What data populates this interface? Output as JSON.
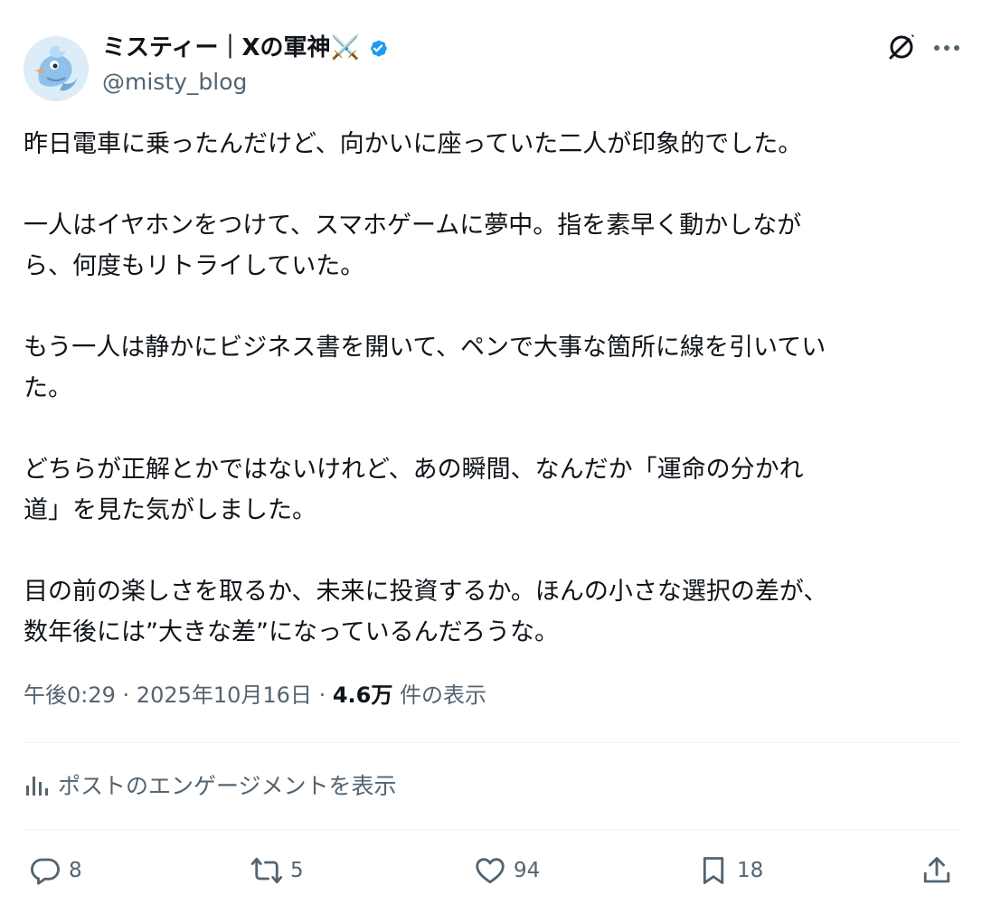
{
  "author": {
    "display_name": "ミスティー｜Xの軍神⚔️",
    "handle": "@misty_blog",
    "verified_color": "#1d9bf0"
  },
  "tweet": {
    "paragraphs": [
      "昨日電車に乗ったんだけど、向かいに座っていた二人が印象的でした。",
      "一人はイヤホンをつけて、スマホゲームに夢中。指を素早く動かしなが\nら、何度もリトライしていた。",
      "もう一人は静かにビジネス書を開いて、ペンで大事な箇所に線を引いてい\nた。",
      "どちらが正解とかではないけれど、あの瞬間、なんだか「運命の分かれ\n道」を見た気がしました。",
      "目の前の楽しさを取るか、未来に投資するか。ほんの小さな選択の差が、\n数年後には”大きな差”になっているんだろうな。"
    ],
    "time": "午後0:29",
    "separator": " · ",
    "date": "2025年10月16日",
    "views_count": "4.6万",
    "views_label": " 件の表示"
  },
  "engagement": {
    "label": "ポストのエンゲージメントを表示"
  },
  "actions": {
    "reply_count": "8",
    "repost_count": "5",
    "like_count": "94",
    "bookmark_count": "18"
  },
  "icons": {
    "avatar": "phoenix-avatar-icon",
    "verified": "verified-badge-icon",
    "grok": "grok-icon",
    "more": "more-icon",
    "analytics": "bar-chart-icon",
    "reply": "reply-icon",
    "repost": "repost-icon",
    "like": "heart-icon",
    "bookmark": "bookmark-icon",
    "share": "share-icon"
  },
  "colors": {
    "text_primary": "#0f1419",
    "text_secondary": "#536471",
    "accent_blue": "#1d9bf0",
    "divider": "#eff3f4"
  }
}
